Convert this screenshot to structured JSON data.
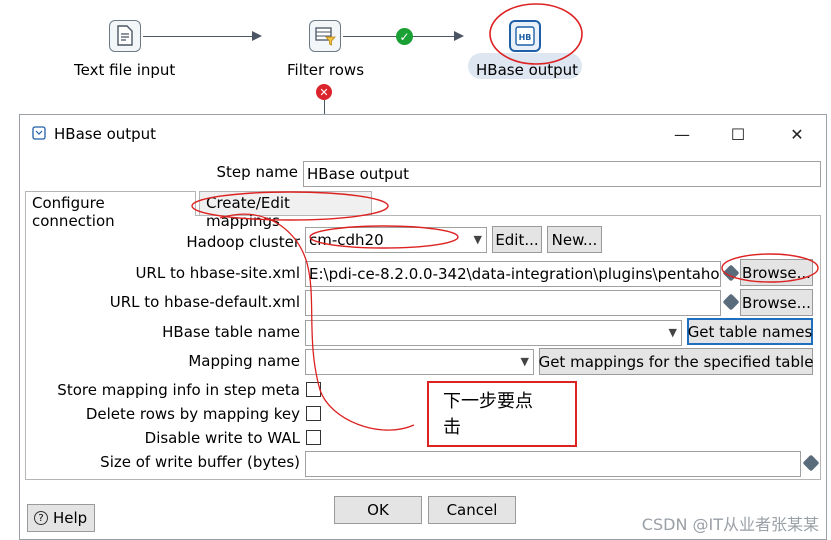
{
  "canvas": {
    "steps": [
      {
        "label": "Text file input",
        "icon": "text-file-input-icon"
      },
      {
        "label": "Filter rows",
        "icon": "filter-rows-icon"
      },
      {
        "label": "HBase output",
        "icon": "hbase-output-icon",
        "icon_text": "HB"
      }
    ],
    "hop_status": [
      "",
      "ok-check-icon",
      "error-x-icon"
    ]
  },
  "dialog": {
    "title": "HBase output",
    "window_buttons": {
      "minimize": "—",
      "maximize": "☐",
      "close": "✕"
    },
    "step_name_label": "Step name",
    "step_name_value": "HBase output",
    "tabs": [
      "Configure connection",
      "Create/Edit mappings"
    ],
    "hadoop_cluster_label": "Hadoop cluster",
    "hadoop_cluster_value": "cm-cdh20",
    "edit_button": "Edit...",
    "new_button": "New...",
    "url_site_label": "URL to hbase-site.xml",
    "url_site_value": "E:\\pdi-ce-8.2.0.0-342\\data-integration\\plugins\\pentaho-",
    "browse_button": "Browse...",
    "url_default_label": "URL to hbase-default.xml",
    "url_default_value": "",
    "table_name_label": "HBase table name",
    "table_name_value": "",
    "get_table_names_button": "Get table names",
    "mapping_name_label": "Mapping name",
    "mapping_name_value": "",
    "get_mappings_button": "Get mappings for the specified table",
    "store_mapping_label": "Store mapping info in step meta",
    "delete_rows_label": "Delete rows by mapping key",
    "disable_wal_label": "Disable write to WAL",
    "buffer_size_label": "Size of write buffer (bytes)",
    "buffer_size_value": "",
    "ok_button": "OK",
    "cancel_button": "Cancel",
    "help_button": "Help"
  },
  "annotation": {
    "line1": "下一步要点",
    "line2": "击",
    "color": "#dd2222"
  },
  "watermark": "CSDN @IT从业者张某某"
}
